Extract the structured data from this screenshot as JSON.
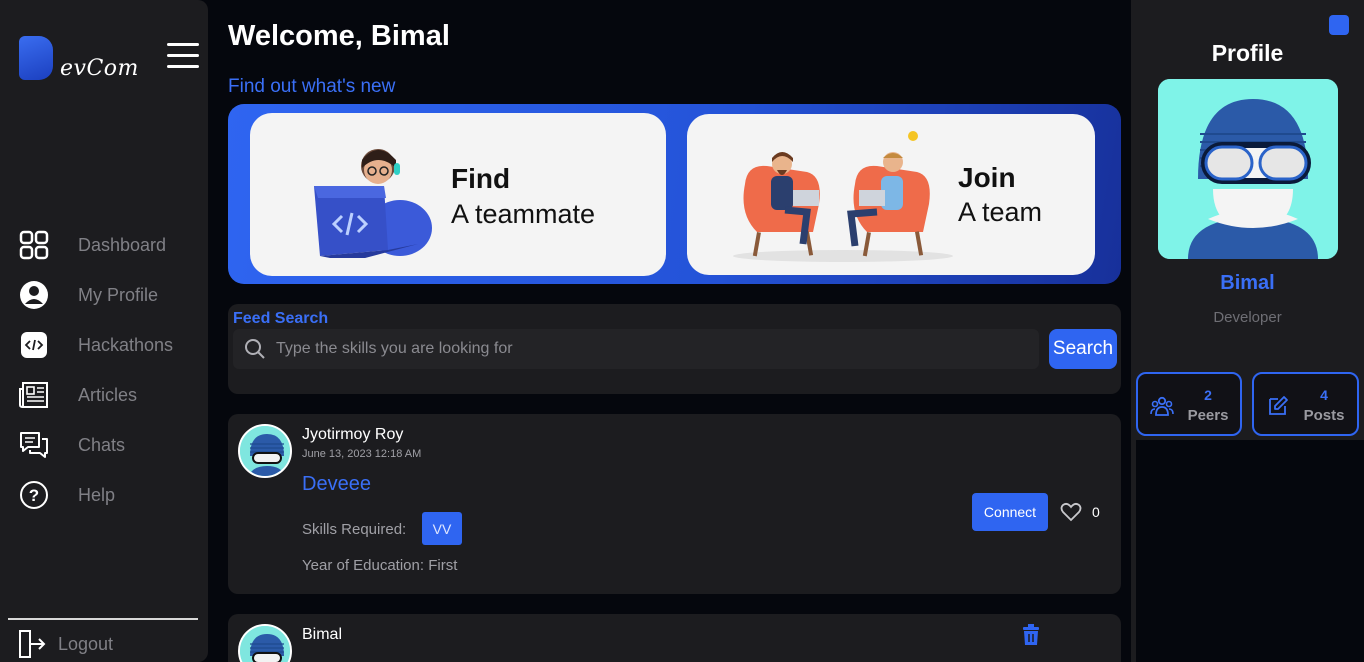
{
  "sidebar": {
    "logo_text": "evCom",
    "items": [
      {
        "label": "Dashboard",
        "icon": "dashboard-icon"
      },
      {
        "label": "My Profile",
        "icon": "user-circle-icon"
      },
      {
        "label": "Hackathons",
        "icon": "code-icon"
      },
      {
        "label": "Articles",
        "icon": "newspaper-icon"
      },
      {
        "label": "Chats",
        "icon": "chat-icon"
      },
      {
        "label": "Help",
        "icon": "help-icon"
      }
    ],
    "logout_label": "Logout"
  },
  "header": {
    "welcome": "Welcome, Bimal",
    "subtitle": "Find out what's new"
  },
  "banner": {
    "find": {
      "title": "Find",
      "subtitle": "A teammate"
    },
    "join": {
      "title": "Join",
      "subtitle": "A team"
    }
  },
  "search": {
    "label": "Feed Search",
    "placeholder": "Type the skills you are looking for",
    "button": "Search"
  },
  "posts": [
    {
      "author": "Jyotirmoy Roy",
      "time": "June 13, 2023 12:18 AM",
      "title": "Deveee",
      "skills_label": "Skills Required:",
      "skills": [
        "VV"
      ],
      "education": "Year of Education: First",
      "connect_label": "Connect",
      "likes": "0"
    },
    {
      "author": "Bimal"
    }
  ],
  "profile": {
    "title": "Profile",
    "name": "Bimal",
    "role": "Developer",
    "peers_count": "2",
    "peers_label": "Peers",
    "posts_count": "4",
    "posts_label": "Posts"
  },
  "colors": {
    "accent": "#2f65f1",
    "panel": "#1c1c1f",
    "background": "#05070d"
  }
}
